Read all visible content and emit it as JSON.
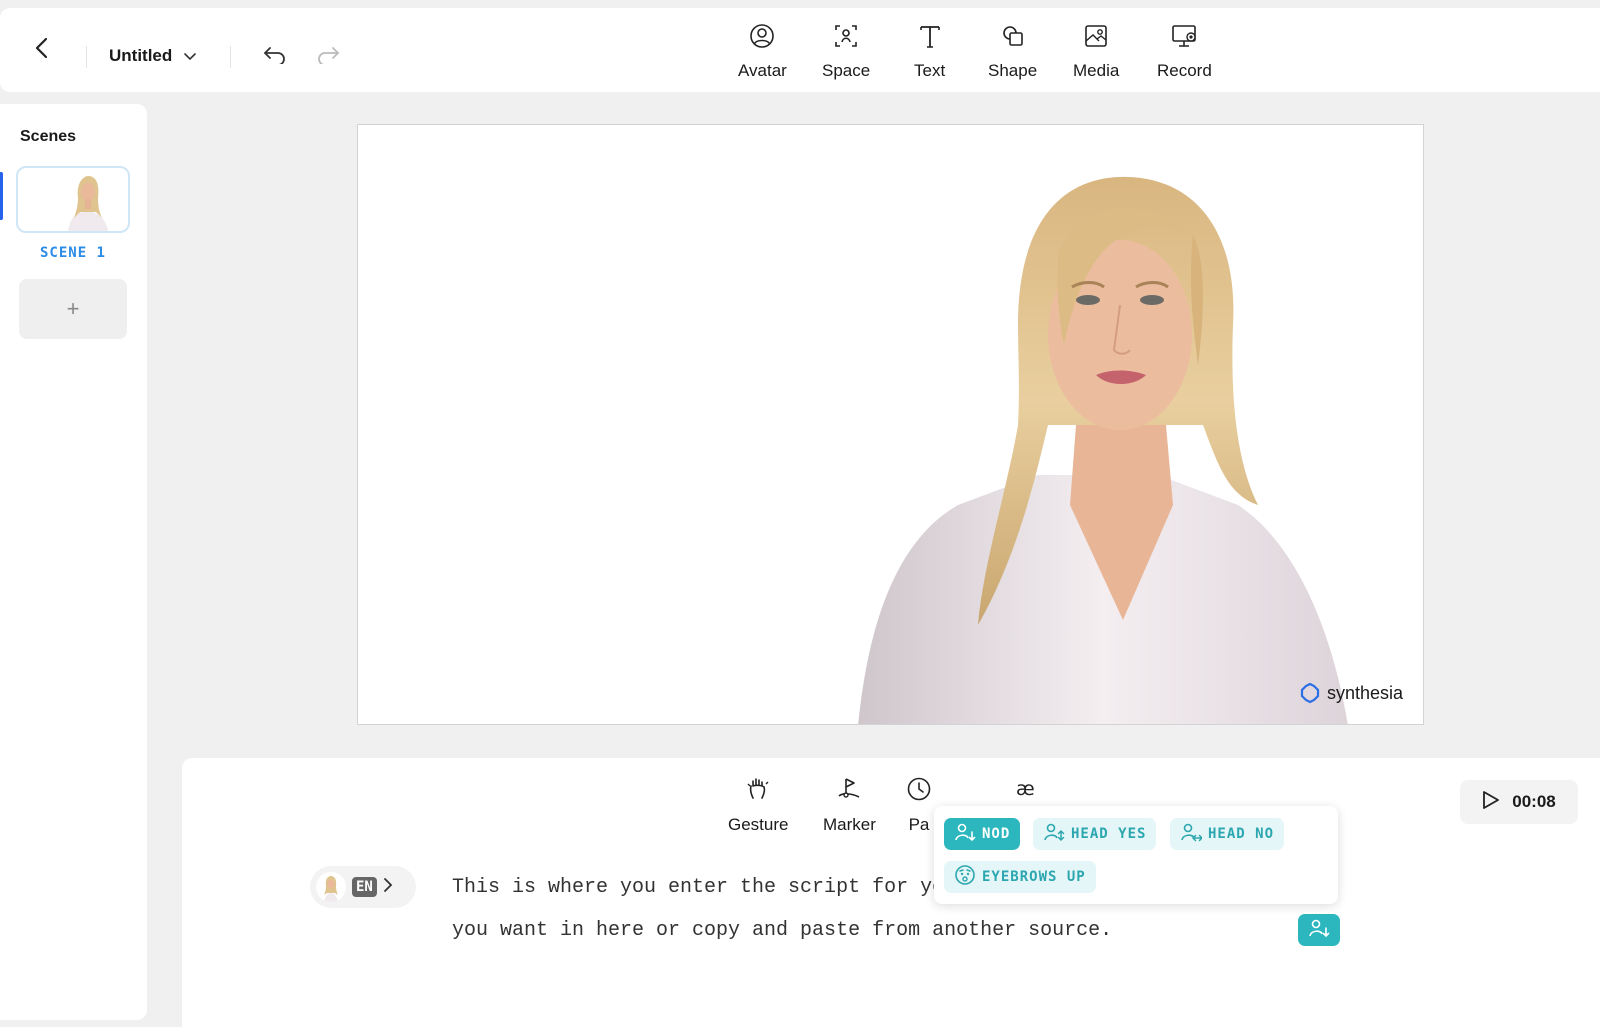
{
  "header": {
    "title": "Untitled",
    "tools": [
      {
        "icon": "avatar-icon",
        "label": "Avatar"
      },
      {
        "icon": "space-icon",
        "label": "Space"
      },
      {
        "icon": "text-icon",
        "label": "Text"
      },
      {
        "icon": "shape-icon",
        "label": "Shape"
      },
      {
        "icon": "media-icon",
        "label": "Media"
      },
      {
        "icon": "record-icon",
        "label": "Record"
      }
    ]
  },
  "sidebar": {
    "title": "Scenes",
    "scenes": [
      {
        "label": "SCENE 1"
      }
    ],
    "add_label": "+"
  },
  "canvas": {
    "logo_text": "synthesia"
  },
  "script": {
    "tools": [
      {
        "icon": "gesture-icon",
        "label": "Gesture"
      },
      {
        "icon": "marker-icon",
        "label": "Marker"
      },
      {
        "icon": "pause-icon",
        "label": "Pa"
      },
      {
        "icon": "pronunciation-icon",
        "label": ""
      }
    ],
    "duration": "00:08",
    "language": "EN",
    "lines": [
      "This is where you enter the script for yo",
      "you want in here or copy and paste from another source."
    ],
    "gesture_popover": {
      "chips": [
        {
          "label": "NOD",
          "active": true,
          "icon": "nod-icon"
        },
        {
          "label": "HEAD YES",
          "active": false,
          "icon": "head-yes-icon"
        },
        {
          "label": "HEAD NO",
          "active": false,
          "icon": "head-no-icon"
        },
        {
          "label": "EYEBROWS UP",
          "active": false,
          "icon": "eyebrows-up-icon"
        }
      ]
    }
  },
  "colors": {
    "accent_blue": "#2b8be6",
    "gesture_teal": "#2cb7bf",
    "gesture_teal_light": "#e4f6f7"
  }
}
